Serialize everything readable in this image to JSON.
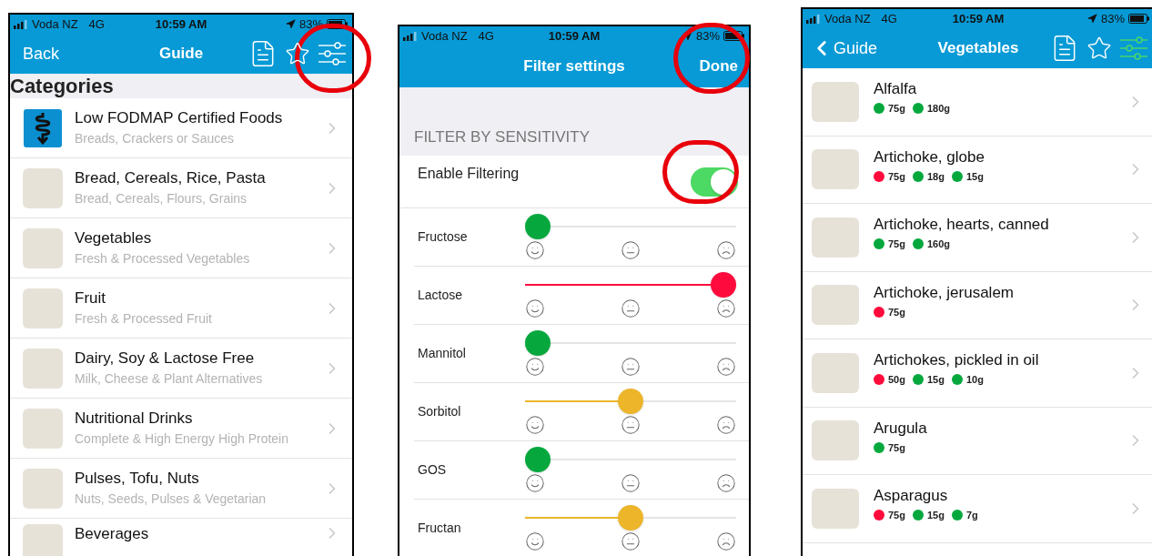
{
  "guide_screen": {
    "status_bar": {
      "carrier": "Voda NZ",
      "network": "4G",
      "time": "10:59 AM",
      "battery": "83%"
    },
    "nav": {
      "back": "Back",
      "back_chevron": false,
      "title": "Guide",
      "filter_active": false
    },
    "section_header": "Categories",
    "rows": [
      {
        "kind": "logo",
        "title": "Low FODMAP Certified Foods",
        "subtitle": "Breads, Crackers or Sauces"
      },
      {
        "kind": "photo",
        "title": "Bread, Cereals, Rice, Pasta",
        "subtitle": "Bread, Cereals, Flours, Grains"
      },
      {
        "kind": "photo",
        "title": "Vegetables",
        "subtitle": "Fresh & Processed Vegetables"
      },
      {
        "kind": "photo",
        "title": "Fruit",
        "subtitle": "Fresh & Processed Fruit"
      },
      {
        "kind": "photo",
        "title": "Dairy, Soy & Lactose Free",
        "subtitle": "Milk, Cheese & Plant Alternatives"
      },
      {
        "kind": "photo",
        "title": "Nutritional Drinks",
        "subtitle": "Complete & High Energy High Protein"
      },
      {
        "kind": "photo",
        "title": "Pulses, Tofu, Nuts",
        "subtitle": "Nuts, Seeds, Pulses & Vegetarian"
      },
      {
        "kind": "photo",
        "title": "Beverages"
      }
    ]
  },
  "filter_screen": {
    "status_bar": {
      "carrier": "Voda NZ",
      "network": "4G",
      "time": "10:59 AM",
      "battery": "83%"
    },
    "nav": {
      "title": "Filter settings",
      "done": "Done"
    },
    "section_header": "FILTER BY SENSITIVITY",
    "toggle": {
      "label": "Enable Filtering",
      "on": true
    },
    "sliders": [
      {
        "name": "Fructose",
        "level": 0
      },
      {
        "name": "Lactose",
        "level": 1
      },
      {
        "name": "Mannitol",
        "level": 0
      },
      {
        "name": "Sorbitol",
        "level": 0.5
      },
      {
        "name": "GOS",
        "level": 0
      },
      {
        "name": "Fructan",
        "level": 0.5
      }
    ]
  },
  "vegetables_screen": {
    "status_bar": {
      "carrier": "Voda NZ",
      "network": "4G",
      "time": "10:59 AM",
      "battery": "83%"
    },
    "nav": {
      "back": "Guide",
      "back_chevron": true,
      "title": "Vegetables",
      "filter_active": true
    },
    "rows": [
      {
        "title": "Alfalfa",
        "portions": [
          {
            "amount": "75g",
            "color": "#06a83e"
          },
          {
            "amount": "180g",
            "color": "#06a83e"
          }
        ]
      },
      {
        "title": "Artichoke, globe",
        "portions": [
          {
            "amount": "75g",
            "color": "#ff0a3c"
          },
          {
            "amount": "18g",
            "color": "#06a83e"
          },
          {
            "amount": "15g",
            "color": "#06a83e"
          }
        ]
      },
      {
        "title": "Artichoke, hearts, canned",
        "portions": [
          {
            "amount": "75g",
            "color": "#06a83e"
          },
          {
            "amount": "160g",
            "color": "#06a83e"
          }
        ]
      },
      {
        "title": "Artichoke, jerusalem",
        "portions": [
          {
            "amount": "75g",
            "color": "#ff0a3c"
          }
        ]
      },
      {
        "title": "Artichokes, pickled in oil",
        "portions": [
          {
            "amount": "50g",
            "color": "#ff0a3c"
          },
          {
            "amount": "15g",
            "color": "#06a83e"
          },
          {
            "amount": "10g",
            "color": "#06a83e"
          }
        ]
      },
      {
        "title": "Arugula",
        "portions": [
          {
            "amount": "75g",
            "color": "#06a83e"
          }
        ]
      },
      {
        "title": "Asparagus",
        "portions": [
          {
            "amount": "75g",
            "color": "#ff0a3c"
          },
          {
            "amount": "15g",
            "color": "#06a83e"
          },
          {
            "amount": "7g",
            "color": "#06a83e"
          }
        ]
      }
    ]
  }
}
